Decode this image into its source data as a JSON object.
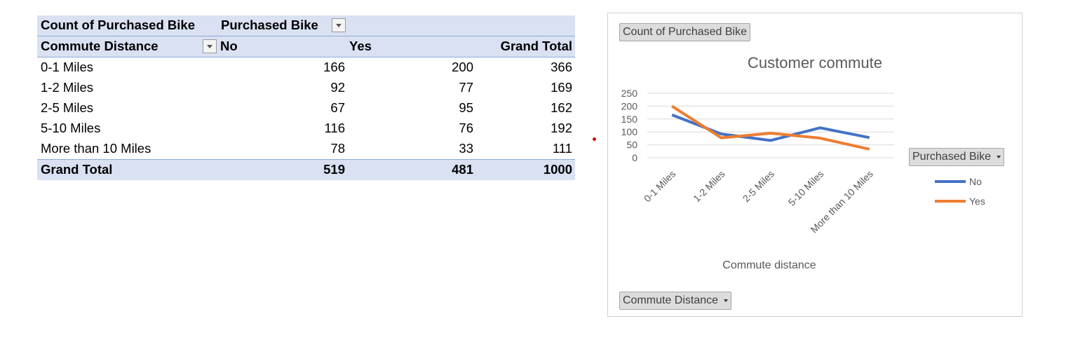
{
  "pivot": {
    "header1": {
      "values_label": "Count of Purchased Bike",
      "column_field": "Purchased Bike"
    },
    "header2": {
      "row_field": "Commute Distance",
      "col_no": "No",
      "col_yes": "Yes",
      "col_total": "Grand Total"
    },
    "rows": [
      {
        "label": "0-1 Miles",
        "no": "166",
        "yes": "200",
        "total": "366"
      },
      {
        "label": "1-2 Miles",
        "no": "92",
        "yes": "77",
        "total": "169"
      },
      {
        "label": "2-5 Miles",
        "no": "67",
        "yes": "95",
        "total": "162"
      },
      {
        "label": "5-10 Miles",
        "no": "116",
        "yes": "76",
        "total": "192"
      },
      {
        "label": "More than 10 Miles",
        "no": "78",
        "yes": "33",
        "total": "111"
      }
    ],
    "grand_total": {
      "label": "Grand Total",
      "no": "519",
      "yes": "481",
      "total": "1000"
    }
  },
  "chart_buttons": {
    "values_button": "Count of Purchased Bike",
    "legend_field_button": "Purchased Bike",
    "axis_field_button": "Commute Distance"
  },
  "chart_data": {
    "type": "line",
    "title": "Customer commute",
    "xlabel": "Commute distance",
    "ylabel": "",
    "categories": [
      "0-1 Miles",
      "1-2 Miles",
      "2-5 Miles",
      "5-10 Miles",
      "More than 10 Miles"
    ],
    "series": [
      {
        "name": "No",
        "values": [
          166,
          92,
          67,
          116,
          78
        ],
        "color": "#4472c4"
      },
      {
        "name": "Yes",
        "values": [
          200,
          77,
          95,
          76,
          33
        ],
        "color": "#ed7d31"
      }
    ],
    "ylim": [
      0,
      250
    ],
    "yticks": [
      0,
      50,
      100,
      150,
      200,
      250
    ],
    "grid": true,
    "legend_position": "right"
  }
}
